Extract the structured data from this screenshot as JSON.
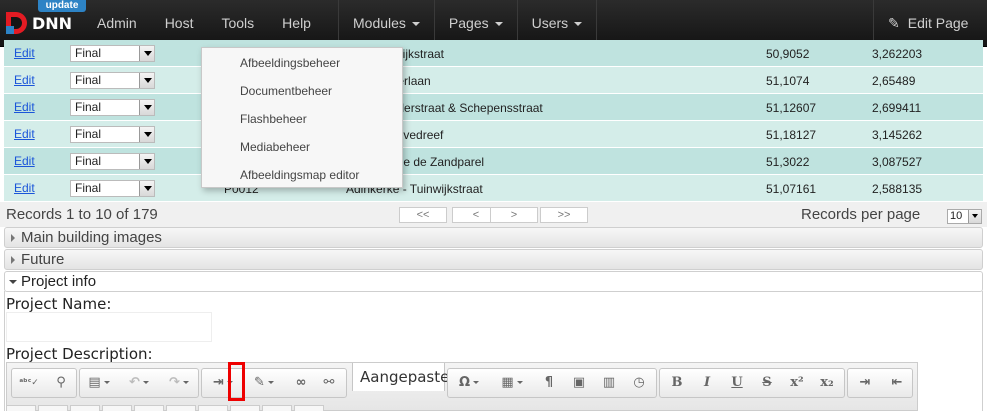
{
  "topbar": {
    "badge": "update",
    "logo_text": "DNN",
    "nav_left": [
      "Admin",
      "Host",
      "Tools",
      "Help"
    ],
    "nav_mid": [
      "Modules",
      "Pages",
      "Users"
    ],
    "edit_page": "Edit Page"
  },
  "grid": {
    "rows": [
      {
        "edit": "Edit",
        "status": "Final",
        "code": "",
        "name": "ster - Kortrijkstraat",
        "lat": "50,9052",
        "lon": "3,262203"
      },
      {
        "edit": "Edit",
        "status": "Final",
        "code": "",
        "name": "Houtsaegerlaan",
        "lat": "51,1074",
        "lon": "2,65489"
      },
      {
        "edit": "Edit",
        "status": "Final",
        "code": "",
        "name": "erke - Polderstraat & Schepensstraat",
        "lat": "51,12607",
        "lon": "2,699411"
      },
      {
        "edit": "Edit",
        "status": "Final",
        "code": "",
        "name": "- Mariënhovedreef",
        "lat": "51,18127",
        "lon": "3,145262"
      },
      {
        "edit": "Edit",
        "status": "Final",
        "code": "",
        "name": "- Residentie de Zandparel",
        "lat": "51,3022",
        "lon": "3,087527"
      },
      {
        "edit": "Edit",
        "status": "Final",
        "code": "P0012",
        "name": "Adinkerke - Tuinwijkstraat",
        "lat": "51,07161",
        "lon": "2,588135"
      }
    ]
  },
  "dropdown": {
    "items": [
      "Afbeeldingsbeheer",
      "Documentbeheer",
      "Flashbeheer",
      "Mediabeheer",
      "Afbeeldingsmap editor"
    ]
  },
  "pager": {
    "records": "Records 1 to 10 of 179",
    "buttons": [
      "<<",
      "<",
      ">",
      ">>"
    ],
    "per_page_label": "Records per page",
    "per_page_value": "10"
  },
  "sections": {
    "main_images": "Main building images",
    "future": "Future",
    "project_info": "Project info"
  },
  "form": {
    "project_name_label": "Project Name:",
    "project_description_label": "Project Description:"
  },
  "toolbar": {
    "format_value": "Aangepaste"
  }
}
